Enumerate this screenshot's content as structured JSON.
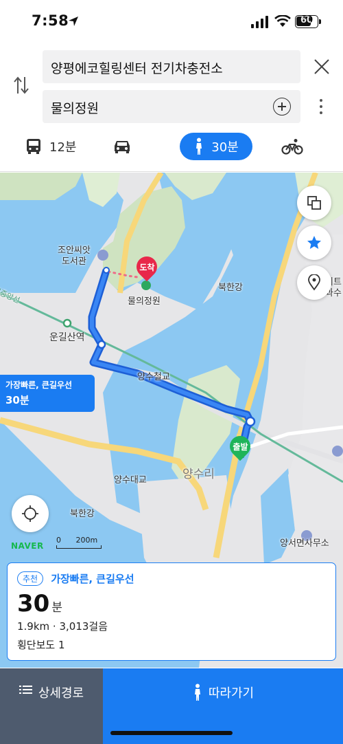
{
  "status_bar": {
    "time": "7:58",
    "battery": "60"
  },
  "search": {
    "origin": "양평에코힐링센터 전기차충전소",
    "destination": "물의정원"
  },
  "modes": {
    "transit_time": "12분",
    "walk_time": "30분"
  },
  "map": {
    "labels": {
      "library": "조안씨앗\n도서관",
      "station": "운길산역",
      "bridge_rail": "양수철교",
      "bridge_road": "양수대교",
      "district": "양수리",
      "river_north": "북한강",
      "river_south": "북한강",
      "rail_line": "경의중앙선",
      "office": "양서면사무소",
      "destination_poi": "물의정원",
      "right_edge": "리트\n과수"
    },
    "arrival_marker": "도착",
    "departure_marker": "출발",
    "callout": {
      "title": "가장빠른, 큰길우선",
      "time": "30분"
    },
    "brand": "NAVER",
    "scale": {
      "zero": "0",
      "distance": "200m"
    }
  },
  "route_card": {
    "badge": "추천",
    "name": "가장빠른, 큰길우선",
    "duration_value": "30",
    "duration_unit": "분",
    "distance_steps": "1.9km · 3,013걸음",
    "crosswalks": "횡단보도 1"
  },
  "actions": {
    "detail_label": "상세경로",
    "follow_label": "따라가기"
  },
  "colors": {
    "accent": "#1a7cf2",
    "water": "#8cc8f2",
    "park": "#cfe3c1",
    "road": "#f7d77a",
    "arrival": "#e8284a",
    "departure": "#1fb45a"
  }
}
